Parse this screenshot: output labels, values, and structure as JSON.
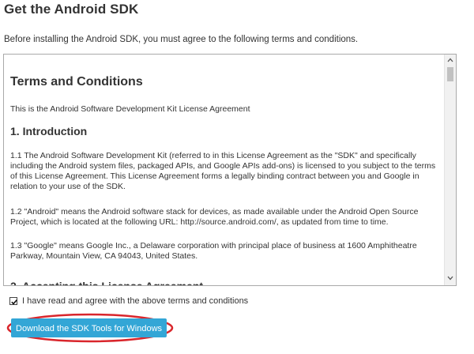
{
  "page": {
    "title": "Get the Android SDK",
    "intro": "Before installing the Android SDK, you must agree to the following terms and conditions."
  },
  "terms": {
    "heading": "Terms and Conditions",
    "agreement_line": "This is the Android Software Development Kit License Agreement",
    "section1_heading": "1. Introduction",
    "paragraph_1_1": "1.1 The Android Software Development Kit (referred to in this License Agreement as the \"SDK\" and specifically including the Android system files, packaged APIs, and Google APIs add-ons) is licensed to you subject to the terms of this License Agreement. This License Agreement forms a legally binding contract between you and Google in relation to your use of the SDK.",
    "paragraph_1_2": "1.2 \"Android\" means the Android software stack for devices, as made available under the Android Open Source Project, which is located at the following URL: http://source.android.com/, as updated from time to time.",
    "paragraph_1_3": "1.3 \"Google\" means Google Inc., a Delaware corporation with principal place of business at 1600 Amphitheatre Parkway, Mountain View, CA 94043, United States."
  },
  "agreement": {
    "checked": true,
    "label": "I have read and agree with the above terms and conditions"
  },
  "download": {
    "label": "Download the SDK Tools for Windows",
    "button_color": "#33a6d6",
    "highlight_color": "#d9262c"
  },
  "icons": {
    "scroll_up": "chevron-up-icon",
    "scroll_down": "chevron-down-icon",
    "check": "checkmark-icon"
  }
}
